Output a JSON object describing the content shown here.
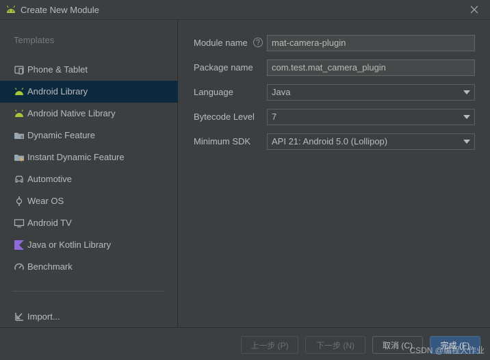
{
  "window": {
    "title": "Create New Module"
  },
  "sidebar": {
    "heading": "Templates",
    "items": [
      {
        "label": "Phone & Tablet",
        "icon": "phone-tablet-icon"
      },
      {
        "label": "Android Library",
        "icon": "android-icon",
        "selected": true
      },
      {
        "label": "Android Native Library",
        "icon": "android-icon"
      },
      {
        "label": "Dynamic Feature",
        "icon": "folder-icon"
      },
      {
        "label": "Instant Dynamic Feature",
        "icon": "folder-lightning-icon"
      },
      {
        "label": "Automotive",
        "icon": "car-icon"
      },
      {
        "label": "Wear OS",
        "icon": "watch-icon"
      },
      {
        "label": "Android TV",
        "icon": "tv-icon"
      },
      {
        "label": "Java or Kotlin Library",
        "icon": "kotlin-icon"
      },
      {
        "label": "Benchmark",
        "icon": "gauge-icon"
      }
    ],
    "import_label": "Import..."
  },
  "form": {
    "module_name": {
      "label": "Module name",
      "value": "mat-camera-plugin"
    },
    "package_name": {
      "label": "Package name",
      "value": "com.test.mat_camera_plugin"
    },
    "language": {
      "label": "Language",
      "value": "Java"
    },
    "bytecode_level": {
      "label": "Bytecode Level",
      "value": "7"
    },
    "minimum_sdk": {
      "label": "Minimum SDK",
      "value": "API 21: Android 5.0 (Lollipop)"
    }
  },
  "footer": {
    "previous_label": "上一步 (P)",
    "next_label": "下一步 (N)",
    "cancel_label": "取消 (C)",
    "finish_label": "完成 (F)",
    "watermark": "CSDN @编程大作业"
  },
  "colors": {
    "selected_bg": "#0d293e",
    "android_green": "#a4c639",
    "kotlin_purple": "#8f6ad8",
    "primary_button": "#365880"
  }
}
